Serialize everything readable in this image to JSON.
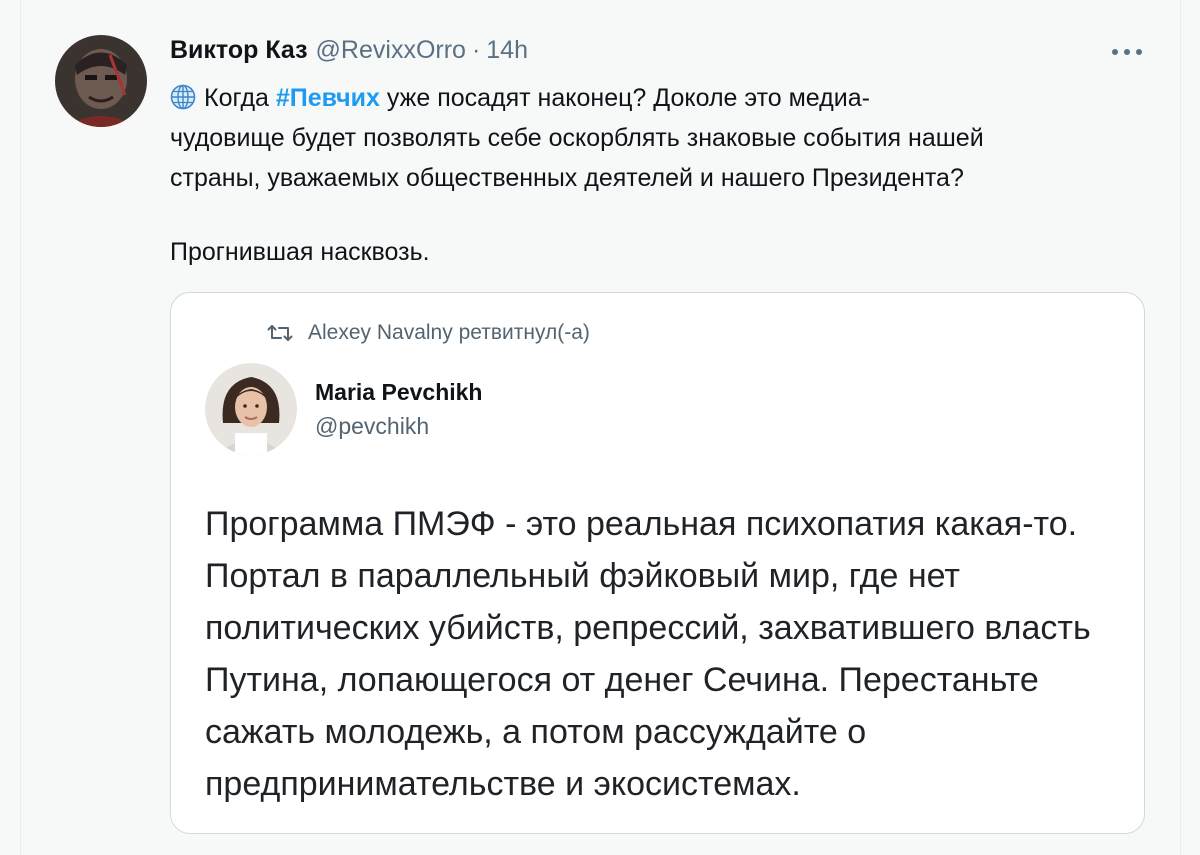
{
  "tweet": {
    "display_name": "Виктор Каз",
    "handle": "@RevixxOrro",
    "separator": "·",
    "time": "14h",
    "body": {
      "line1_before": "Когда ",
      "hashtag": "#Певчих",
      "line1_after": " уже посадят наконец? Доколе это медиа-",
      "line2": "чудовище будет позволять себе оскорблять знаковые события нашей",
      "line3": "страны, уважаемых общественных деятелей и нашего Президента?",
      "line4": "Прогнившая насквозь."
    },
    "icons": {
      "avatar": "user-avatar",
      "more": "more-options-icon",
      "globe": "globe-icon"
    }
  },
  "quoted": {
    "retweet_label": "Alexey Navalny ретвитнул(-а)",
    "display_name": "Maria Pevchikh",
    "handle": "@pevchikh",
    "text_lines": [
      "Программа ПМЭФ - это реальная психопатия какая-то.",
      "Портал в параллельный фэйковый мир, где нет",
      "политических убийств, репрессий, захватившего власть",
      "Путина, лопающегося от денег Сечина. Перестаньте",
      "сажать молодежь, а потом рассуждайте о",
      "предпринимательстве и экосистемах."
    ],
    "icons": {
      "retweet": "retweet-icon",
      "avatar": "user-avatar"
    }
  },
  "colors": {
    "accent": "#1d9bf0",
    "secondary_text": "#5b7083",
    "border": "#cfd9de",
    "background": "#f7f9f9"
  }
}
